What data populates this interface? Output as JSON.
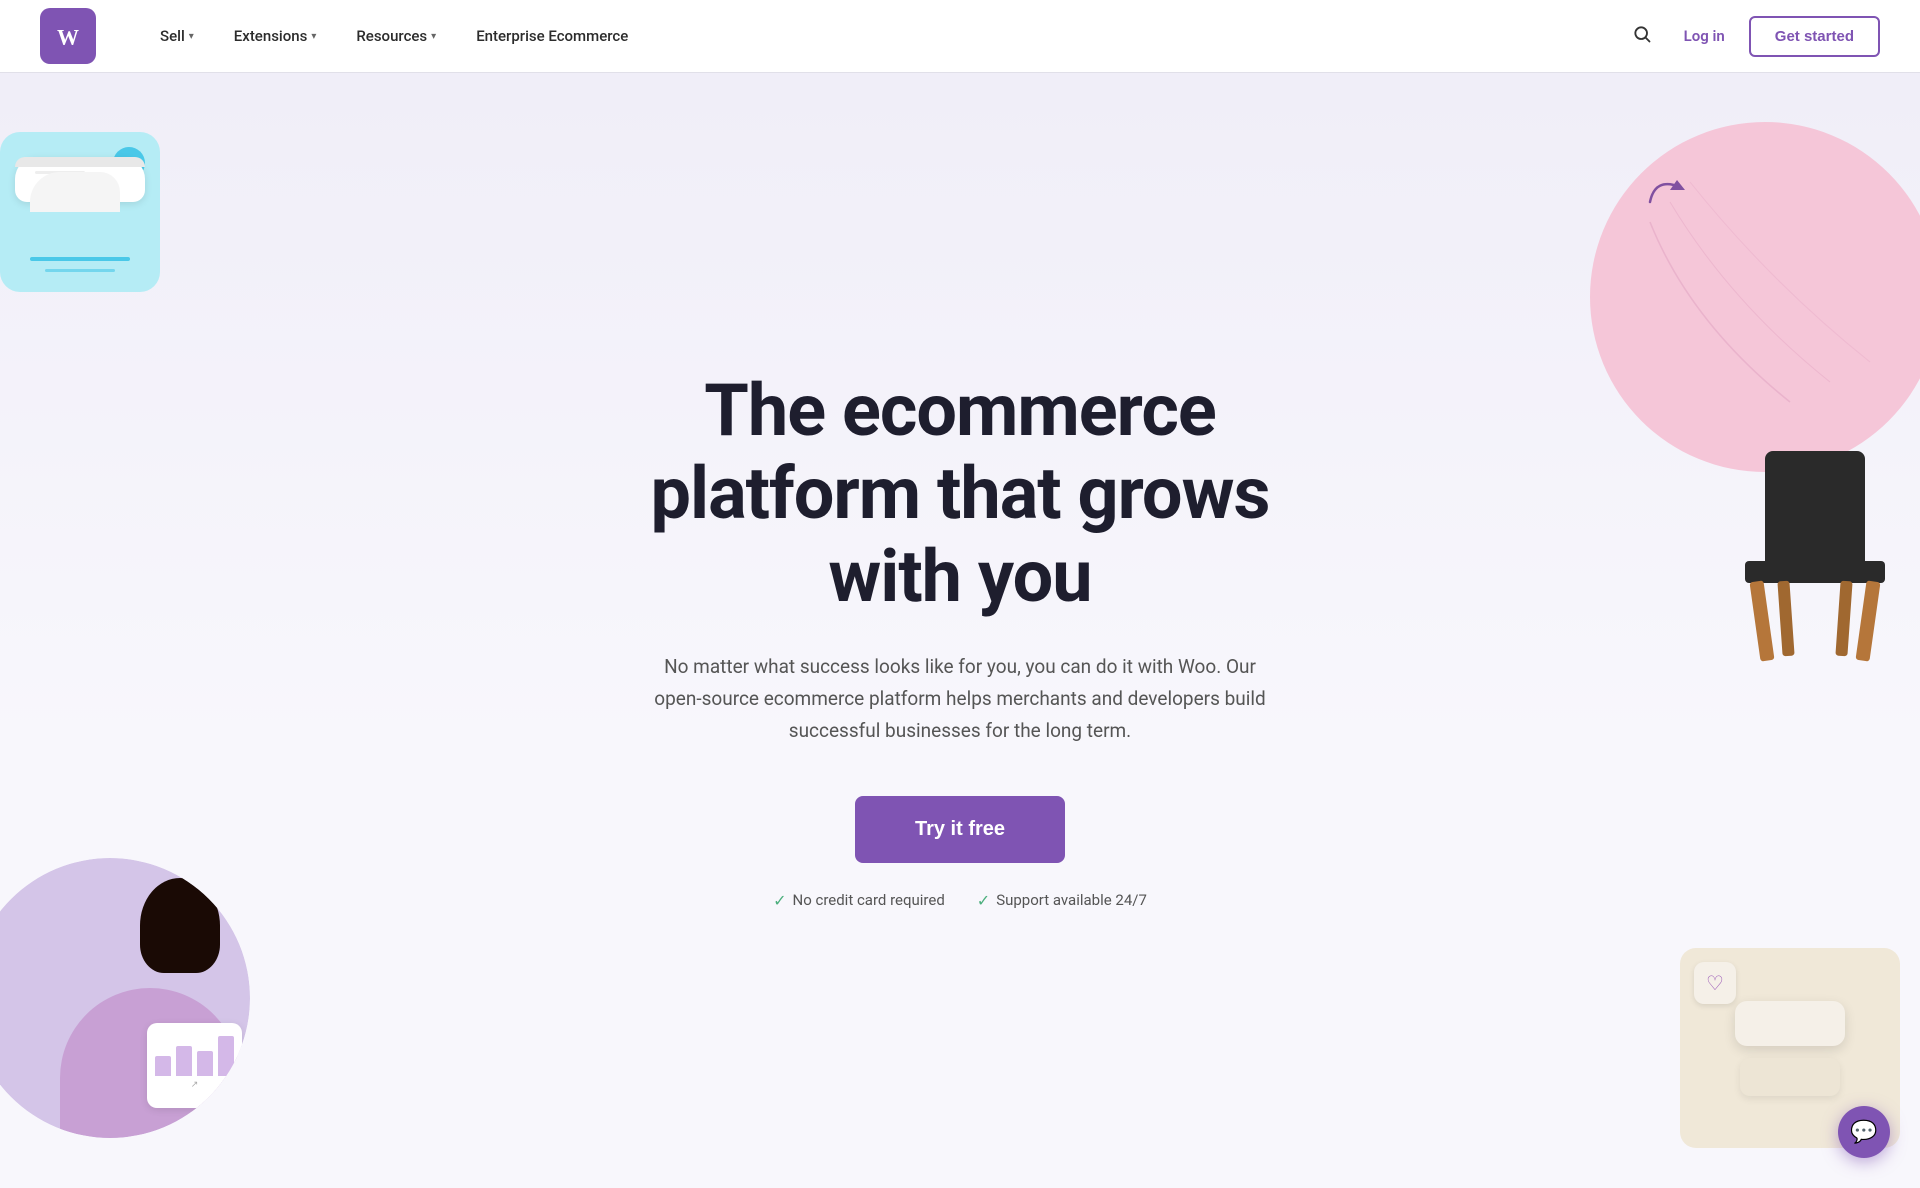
{
  "nav": {
    "logo_alt": "WooCommerce",
    "links": [
      {
        "label": "Sell",
        "has_dropdown": true
      },
      {
        "label": "Extensions",
        "has_dropdown": true
      },
      {
        "label": "Resources",
        "has_dropdown": true
      },
      {
        "label": "Enterprise Ecommerce",
        "has_dropdown": false
      }
    ],
    "search_label": "Search",
    "login_label": "Log in",
    "get_started_label": "Get started"
  },
  "hero": {
    "title": "The ecommerce platform that grows with you",
    "subtitle": "No matter what success looks like for you, you can do it with Woo. Our open-source ecommerce platform helps merchants and developers build successful businesses for the long term.",
    "cta_label": "Try it free",
    "badge_1": "No credit card required",
    "badge_2": "Support available 24/7"
  },
  "chat": {
    "icon": "💬"
  }
}
